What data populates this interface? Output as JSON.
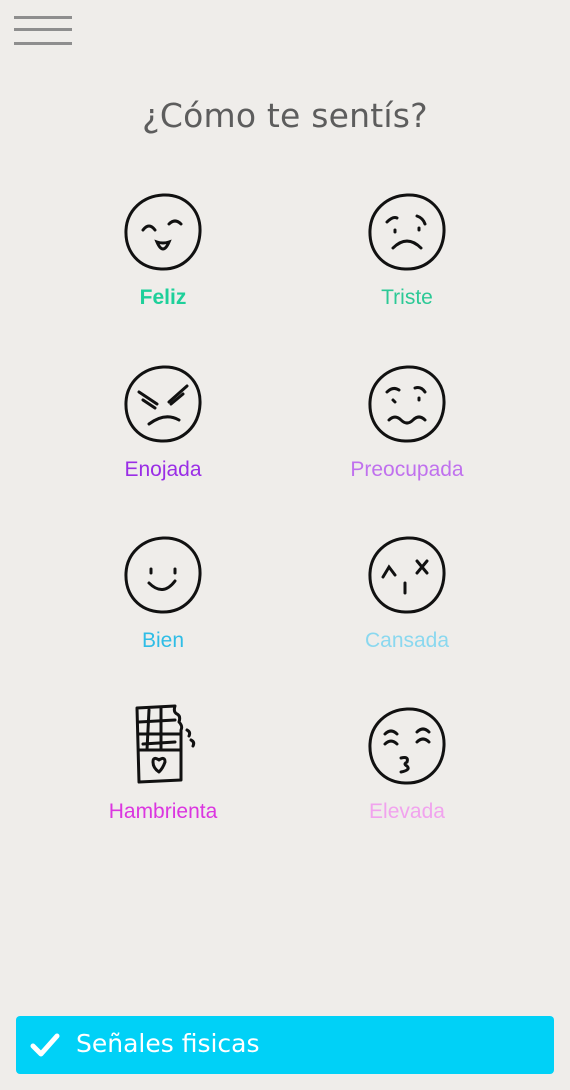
{
  "header": {
    "menu_icon": "hamburger-menu-icon",
    "title": "¿Cómo te sentís?"
  },
  "moods": [
    {
      "label": "Feliz",
      "icon": "happy-face-icon",
      "color": "#1ed09a",
      "selected": true
    },
    {
      "label": "Triste",
      "icon": "sad-face-icon",
      "color": "#2cc996",
      "selected": false
    },
    {
      "label": "Enojada",
      "icon": "angry-face-icon",
      "color": "#9a2ee6",
      "selected": false
    },
    {
      "label": "Preocupada",
      "icon": "worried-face-icon",
      "color": "#c071ee",
      "selected": false
    },
    {
      "label": "Bien",
      "icon": "smile-face-icon",
      "color": "#2fbde6",
      "selected": false
    },
    {
      "label": "Cansada",
      "icon": "tired-face-icon",
      "color": "#8ad8ef",
      "selected": false
    },
    {
      "label": "Hambrienta",
      "icon": "chocolate-bar-icon",
      "color": "#db36e0",
      "selected": false
    },
    {
      "label": "Elevada",
      "icon": "kiss-face-icon",
      "color": "#f1a3ee",
      "selected": false
    }
  ],
  "footer": {
    "button_label": "Señales fisicas",
    "button_icon": "check-icon",
    "button_color": "#00d1f7"
  }
}
